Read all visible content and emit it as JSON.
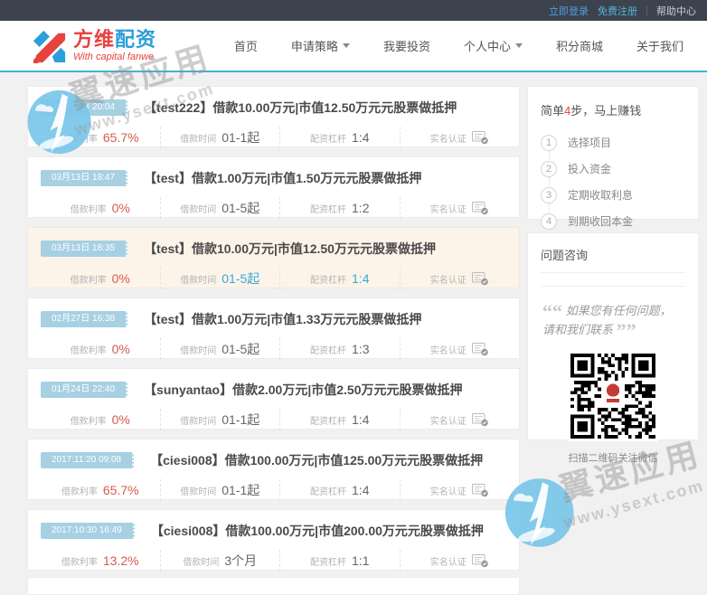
{
  "topbar": {
    "login": "立即登录",
    "register": "免费注册",
    "help": "帮助中心"
  },
  "header": {
    "logo_part1": "方维",
    "logo_part2": "配资",
    "logo_subtitle": "With capital fanwe",
    "nav": [
      {
        "label": "首页",
        "dropdown": false
      },
      {
        "label": "申请策略",
        "dropdown": true
      },
      {
        "label": "我要投资",
        "dropdown": false
      },
      {
        "label": "个人中心",
        "dropdown": true
      },
      {
        "label": "积分商城",
        "dropdown": false
      },
      {
        "label": "关于我们",
        "dropdown": false
      }
    ]
  },
  "listings": {
    "labels": {
      "rate": "借款利率",
      "time": "借款时间",
      "leverage": "配资杠杆",
      "cert": "实名认证"
    },
    "items": [
      {
        "date": "04月10日 20:04",
        "title": "【test222】借款10.00万元|市值12.50万元元股票做抵押",
        "rate": "65.7%",
        "time": "01-1起",
        "leverage": "1:4",
        "highlighted": false
      },
      {
        "date": "03月13日 18:47",
        "title": "【test】借款1.00万元|市值1.50万元元股票做抵押",
        "rate": "0%",
        "time": "01-5起",
        "leverage": "1:2",
        "highlighted": false
      },
      {
        "date": "03月13日 18:35",
        "title": "【test】借款10.00万元|市值12.50万元元股票做抵押",
        "rate": "0%",
        "time": "01-5起",
        "leverage": "1:4",
        "highlighted": true
      },
      {
        "date": "02月27日 16:38",
        "title": "【test】借款1.00万元|市值1.33万元元股票做抵押",
        "rate": "0%",
        "time": "01-5起",
        "leverage": "1:3",
        "highlighted": false
      },
      {
        "date": "01月24日 22:40",
        "title": "【sunyantao】借款2.00万元|市值2.50万元元股票做抵押",
        "rate": "0%",
        "time": "01-1起",
        "leverage": "1:4",
        "highlighted": false
      },
      {
        "date": "2017:11:20 09:08",
        "title": "【ciesi008】借款100.00万元|市值125.00万元元股票做抵押",
        "rate": "65.7%",
        "time": "01-1起",
        "leverage": "1:4",
        "highlighted": false
      },
      {
        "date": "2017:10:30 16:49",
        "title": "【ciesi008】借款100.00万元|市值200.00万元元股票做抵押",
        "rate": "13.2%",
        "time": "3个月",
        "leverage": "1:1",
        "highlighted": false
      }
    ]
  },
  "sidebar": {
    "steps_panel": {
      "title_prefix": "简单",
      "title_num": "4",
      "title_suffix": "步，马上赚钱",
      "steps": [
        {
          "num": "1",
          "label": "选择项目"
        },
        {
          "num": "2",
          "label": "投入资金"
        },
        {
          "num": "3",
          "label": "定期收取利息"
        },
        {
          "num": "4",
          "label": "到期收回本金"
        }
      ]
    },
    "contact_panel": {
      "title": "问题咨询",
      "quote_line1": "如果您有任何问题，",
      "quote_line2": "请和我们联系",
      "qr_caption": "扫描二维码关注微信"
    }
  },
  "watermark": {
    "text": "翼速应用",
    "url": "www.ysext.com"
  },
  "colors": {
    "topbar_bg": "#3d434e",
    "header_accent": "#41b2d8",
    "badge_blue": "#a7d0e3",
    "rate_red": "#d85b51",
    "hover_blue": "#3aa8d8",
    "highlight_bg": "#fcf4e9",
    "logo_red": "#e8423e",
    "logo_blue": "#2b9fd9"
  }
}
